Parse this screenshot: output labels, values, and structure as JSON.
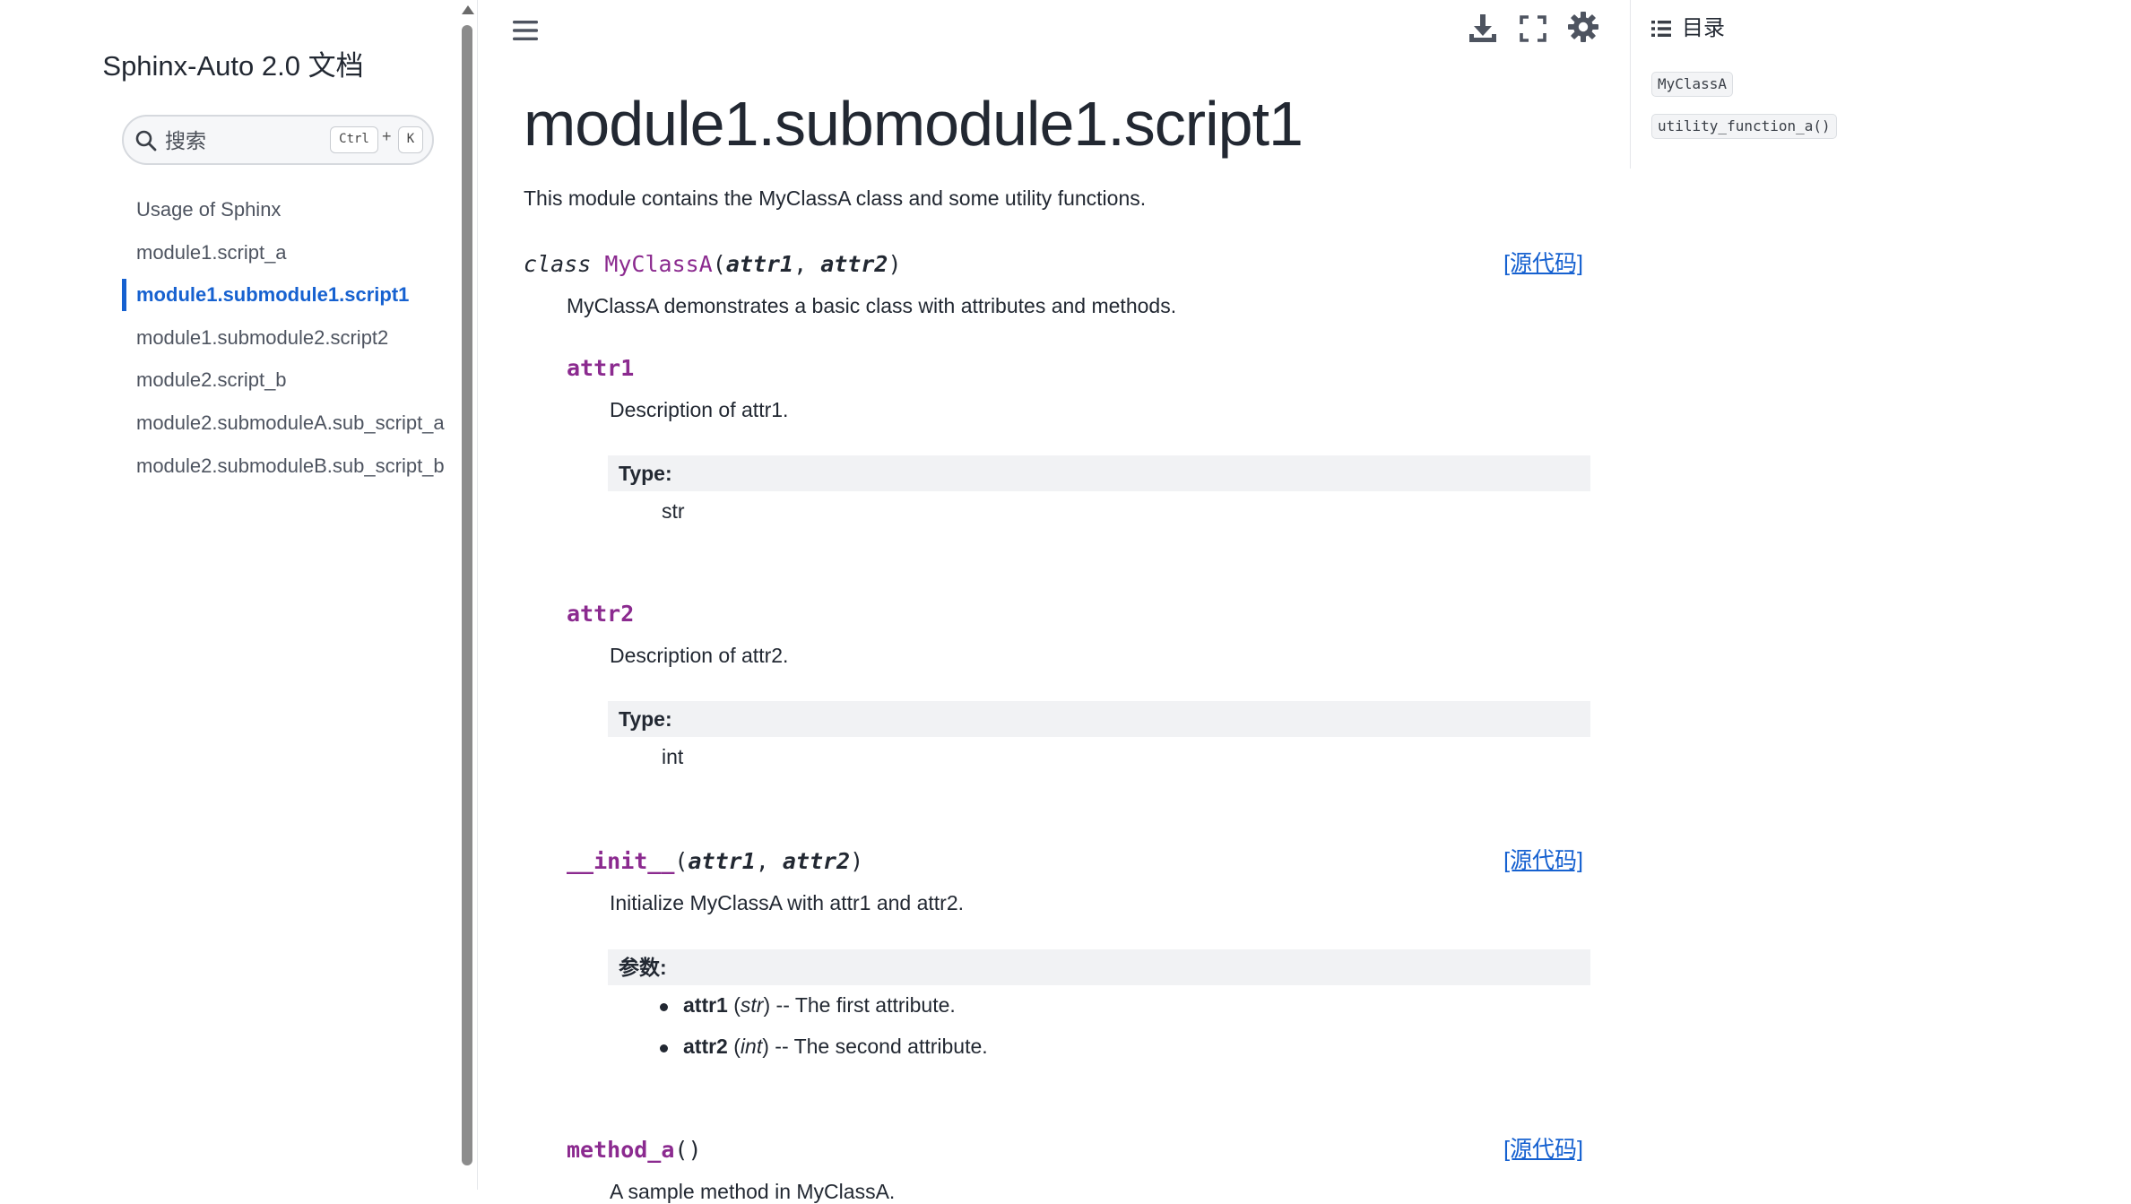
{
  "sidebar": {
    "title": "Sphinx-Auto 2.0 文档",
    "search": {
      "placeholder": "搜索",
      "shortcut_ctrl": "Ctrl",
      "shortcut_plus": "+",
      "shortcut_key": "K"
    },
    "nav": [
      {
        "label": "Usage of Sphinx",
        "active": false
      },
      {
        "label": "module1.script_a",
        "active": false
      },
      {
        "label": "module1.submodule1.script1",
        "active": true
      },
      {
        "label": "module1.submodule2.script2",
        "active": false
      },
      {
        "label": "module2.script_b",
        "active": false
      },
      {
        "label": "module2.submoduleA.sub_script_a",
        "active": false
      },
      {
        "label": "module2.submoduleB.sub_script_b",
        "active": false
      }
    ]
  },
  "header": {
    "icons": [
      "menu-icon",
      "download-icon",
      "fullscreen-icon",
      "theme-gear-icon"
    ]
  },
  "toc": {
    "title": "目录",
    "items": [
      "MyClassA",
      "utility_function_a()"
    ]
  },
  "main": {
    "title": "module1.submodule1.script1",
    "intro": "This module contains the MyClassA class and some utility functions.",
    "source_link": "[源代码]",
    "class_sig": {
      "keyword": "class",
      "name": "MyClassA",
      "open": "(",
      "param1": "attr1",
      "sep": ", ",
      "param2": "attr2",
      "close": ")"
    },
    "class_desc": "MyClassA demonstrates a basic class with attributes and methods.",
    "attr1": {
      "name": "attr1",
      "desc": "Description of attr1.",
      "type_label": "Type:",
      "type_value": "str"
    },
    "attr2": {
      "name": "attr2",
      "desc": "Description of attr2.",
      "type_label": "Type:",
      "type_value": "int"
    },
    "init": {
      "name": "__init__",
      "open": "(",
      "param1": "attr1",
      "sep": ", ",
      "param2": "attr2",
      "close": ")",
      "desc": "Initialize MyClassA with attr1 and attr2.",
      "params_label": "参数:",
      "params": [
        {
          "name": "attr1",
          "type": "str",
          "desc": " -- The first attribute."
        },
        {
          "name": "attr2",
          "type": "int",
          "desc": " -- The second attribute."
        }
      ]
    },
    "method_a": {
      "name": "method_a",
      "parens": "()",
      "desc": "A sample method in MyClassA."
    }
  },
  "colors": {
    "accent": "#1661d0",
    "code_name": "#8b2a8f",
    "field_bg": "#f1f2f4",
    "text": "#222832"
  }
}
